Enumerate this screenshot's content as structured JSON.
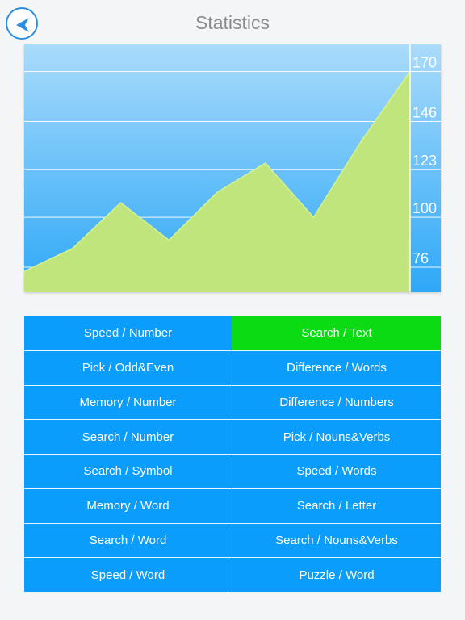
{
  "header": {
    "title": "Statistics",
    "back_icon": "chevron-left-icon"
  },
  "colors": {
    "sky_top": "#a9dbfb",
    "sky_bottom": "#2ea8f7",
    "area_fill": "#c0e57c",
    "area_stroke": "#d6f28f",
    "cell_default": "#0a9dfb",
    "cell_active": "#0adb12"
  },
  "chart_data": {
    "type": "area",
    "x": [
      1,
      2,
      3,
      4,
      5,
      6,
      7,
      8,
      9
    ],
    "y": [
      74,
      85,
      107,
      89,
      112,
      126,
      100,
      137,
      170
    ],
    "ylim": [
      64,
      183
    ],
    "yticks": [
      76,
      100,
      123,
      146,
      170
    ],
    "tick_labels": [
      "76",
      "100",
      "123",
      "146",
      "170"
    ],
    "grid": true,
    "axis_side": "right"
  },
  "tests": [
    {
      "label": "Speed / Number",
      "active": false
    },
    {
      "label": "Search / Text",
      "active": true
    },
    {
      "label": "Pick / Odd&Even",
      "active": false
    },
    {
      "label": "Difference / Words",
      "active": false
    },
    {
      "label": "Memory / Number",
      "active": false
    },
    {
      "label": "Difference / Numbers",
      "active": false
    },
    {
      "label": "Search / Number",
      "active": false
    },
    {
      "label": "Pick / Nouns&Verbs",
      "active": false
    },
    {
      "label": "Search / Symbol",
      "active": false
    },
    {
      "label": "Speed / Words",
      "active": false
    },
    {
      "label": "Memory / Word",
      "active": false
    },
    {
      "label": "Search / Letter",
      "active": false
    },
    {
      "label": "Search / Word",
      "active": false
    },
    {
      "label": "Search / Nouns&Verbs",
      "active": false
    },
    {
      "label": "Speed / Word",
      "active": false
    },
    {
      "label": "Puzzle / Word",
      "active": false
    }
  ]
}
